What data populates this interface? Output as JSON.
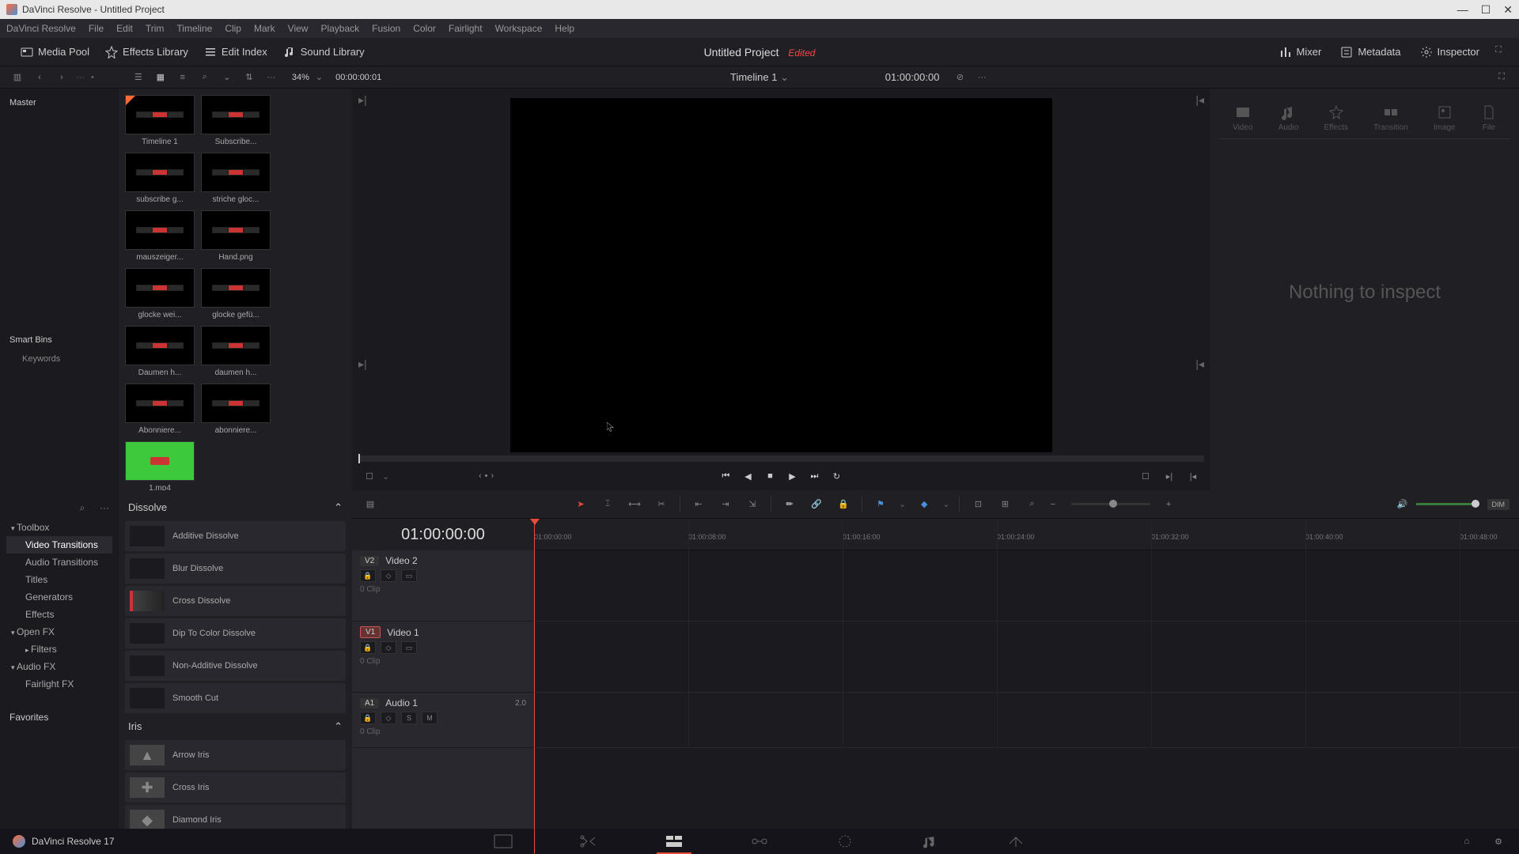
{
  "titlebar": {
    "text": "DaVinci Resolve - Untitled Project"
  },
  "menubar": [
    "DaVinci Resolve",
    "File",
    "Edit",
    "Trim",
    "Timeline",
    "Clip",
    "Mark",
    "View",
    "Playback",
    "Fusion",
    "Color",
    "Fairlight",
    "Workspace",
    "Help"
  ],
  "top_toolbar": {
    "media_pool": "Media Pool",
    "effects_library": "Effects Library",
    "edit_index": "Edit Index",
    "sound_library": "Sound Library",
    "mixer": "Mixer",
    "metadata": "Metadata",
    "inspector": "Inspector"
  },
  "project": {
    "title": "Untitled Project",
    "edited": "Edited"
  },
  "sec_toolbar": {
    "zoom": "34%",
    "source_tc": "00:00:00:01",
    "timeline_name": "Timeline 1",
    "record_tc": "01:00:00:00"
  },
  "bins": {
    "master": "Master",
    "smart_bins": "Smart Bins",
    "keywords": "Keywords"
  },
  "media_items": [
    {
      "name": "Timeline 1",
      "type": "timeline"
    },
    {
      "name": "Subscribe...",
      "type": "clip"
    },
    {
      "name": "subscribe g...",
      "type": "clip"
    },
    {
      "name": "striche gloc...",
      "type": "clip"
    },
    {
      "name": "mauszeiger...",
      "type": "clip"
    },
    {
      "name": "Hand.png",
      "type": "clip"
    },
    {
      "name": "glocke wei...",
      "type": "clip"
    },
    {
      "name": "glocke gefü...",
      "type": "clip"
    },
    {
      "name": "Daumen h...",
      "type": "clip"
    },
    {
      "name": "daumen h...",
      "type": "clip"
    },
    {
      "name": "Abonniere...",
      "type": "clip"
    },
    {
      "name": "abonniere...",
      "type": "clip"
    },
    {
      "name": "1.mp4",
      "type": "green"
    }
  ],
  "inspector_tabs": [
    "Video",
    "Audio",
    "Effects",
    "Transition",
    "Image",
    "File"
  ],
  "inspector_msg": "Nothing to inspect",
  "fx_tree": {
    "toolbox": "Toolbox",
    "video_trans": "Video Transitions",
    "audio_trans": "Audio Transitions",
    "titles": "Titles",
    "generators": "Generators",
    "effects": "Effects",
    "open_fx": "Open FX",
    "filters": "Filters",
    "audio_fx": "Audio FX",
    "fairlight_fx": "Fairlight FX",
    "favorites": "Favorites"
  },
  "fx_groups": {
    "dissolve": {
      "title": "Dissolve",
      "items": [
        "Additive Dissolve",
        "Blur Dissolve",
        "Cross Dissolve",
        "Dip To Color Dissolve",
        "Non-Additive Dissolve",
        "Smooth Cut"
      ]
    },
    "iris": {
      "title": "Iris",
      "items": [
        "Arrow Iris",
        "Cross Iris",
        "Diamond Iris"
      ]
    }
  },
  "timeline": {
    "tc": "01:00:00:00",
    "ruler": [
      "01:00:00:00",
      "01:00:08:00",
      "01:00:16:00",
      "01:00:24:00",
      "01:00:32:00",
      "01:00:40:00",
      "01:00:48:00"
    ],
    "tracks": [
      {
        "tag": "V2",
        "name": "Video 2",
        "clips": "0 Clip",
        "active": false
      },
      {
        "tag": "V1",
        "name": "Video 1",
        "clips": "0 Clip",
        "active": true
      },
      {
        "tag": "A1",
        "name": "Audio 1",
        "clips": "0 Clip",
        "badge": "2.0",
        "active": false,
        "audio": true
      }
    ]
  },
  "bottom": {
    "version": "DaVinci Resolve 17"
  }
}
